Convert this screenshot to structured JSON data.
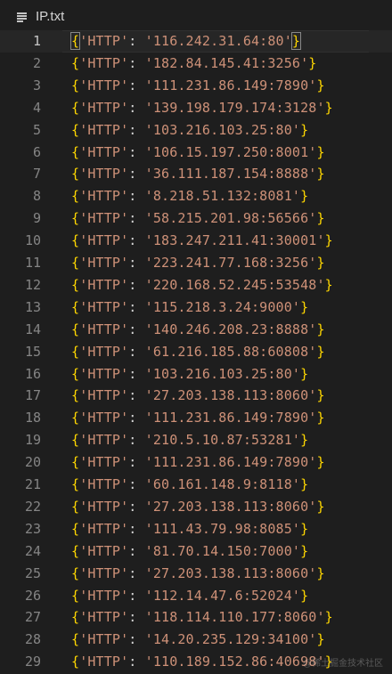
{
  "tab": {
    "label": "IP.txt",
    "icon": "lines-icon"
  },
  "colors": {
    "background": "#1e1e1e",
    "line_number": "#858585",
    "string": "#ce9178",
    "brace": "#ffd700"
  },
  "current_line": 1,
  "lines": [
    {
      "n": "1",
      "key": "'HTTP'",
      "value": "'116.242.31.64:80'"
    },
    {
      "n": "2",
      "key": "'HTTP'",
      "value": "'182.84.145.41:3256'"
    },
    {
      "n": "3",
      "key": "'HTTP'",
      "value": "'111.231.86.149:7890'"
    },
    {
      "n": "4",
      "key": "'HTTP'",
      "value": "'139.198.179.174:3128'"
    },
    {
      "n": "5",
      "key": "'HTTP'",
      "value": "'103.216.103.25:80'"
    },
    {
      "n": "6",
      "key": "'HTTP'",
      "value": "'106.15.197.250:8001'"
    },
    {
      "n": "7",
      "key": "'HTTP'",
      "value": "'36.111.187.154:8888'"
    },
    {
      "n": "8",
      "key": "'HTTP'",
      "value": "'8.218.51.132:8081'"
    },
    {
      "n": "9",
      "key": "'HTTP'",
      "value": "'58.215.201.98:56566'"
    },
    {
      "n": "10",
      "key": "'HTTP'",
      "value": "'183.247.211.41:30001'"
    },
    {
      "n": "11",
      "key": "'HTTP'",
      "value": "'223.241.77.168:3256'"
    },
    {
      "n": "12",
      "key": "'HTTP'",
      "value": "'220.168.52.245:53548'"
    },
    {
      "n": "13",
      "key": "'HTTP'",
      "value": "'115.218.3.24:9000'"
    },
    {
      "n": "14",
      "key": "'HTTP'",
      "value": "'140.246.208.23:8888'"
    },
    {
      "n": "15",
      "key": "'HTTP'",
      "value": "'61.216.185.88:60808'"
    },
    {
      "n": "16",
      "key": "'HTTP'",
      "value": "'103.216.103.25:80'"
    },
    {
      "n": "17",
      "key": "'HTTP'",
      "value": "'27.203.138.113:8060'"
    },
    {
      "n": "18",
      "key": "'HTTP'",
      "value": "'111.231.86.149:7890'"
    },
    {
      "n": "19",
      "key": "'HTTP'",
      "value": "'210.5.10.87:53281'"
    },
    {
      "n": "20",
      "key": "'HTTP'",
      "value": "'111.231.86.149:7890'"
    },
    {
      "n": "21",
      "key": "'HTTP'",
      "value": "'60.161.148.9:8118'"
    },
    {
      "n": "22",
      "key": "'HTTP'",
      "value": "'27.203.138.113:8060'"
    },
    {
      "n": "23",
      "key": "'HTTP'",
      "value": "'111.43.79.98:8085'"
    },
    {
      "n": "24",
      "key": "'HTTP'",
      "value": "'81.70.14.150:7000'"
    },
    {
      "n": "25",
      "key": "'HTTP'",
      "value": "'27.203.138.113:8060'"
    },
    {
      "n": "26",
      "key": "'HTTP'",
      "value": "'112.14.47.6:52024'"
    },
    {
      "n": "27",
      "key": "'HTTP'",
      "value": "'118.114.110.177:8060'"
    },
    {
      "n": "28",
      "key": "'HTTP'",
      "value": "'14.20.235.129:34100'"
    },
    {
      "n": "29",
      "key": "'HTTP'",
      "value": "'110.189.152.86:40698'"
    }
  ],
  "watermark": "@稀土掘金技术社区"
}
